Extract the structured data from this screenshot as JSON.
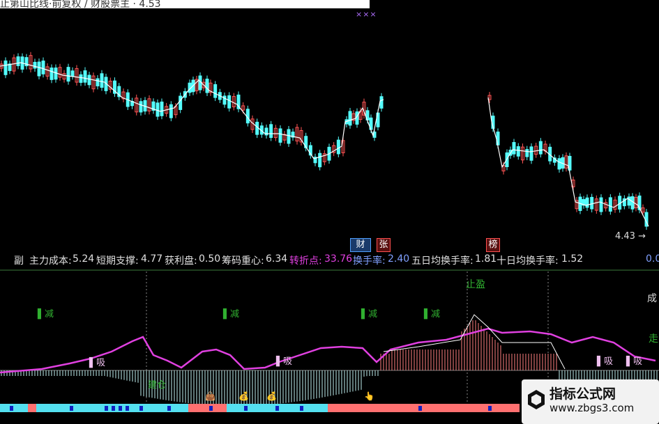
{
  "title_text": "止第山比线·前复权 / 财股票主 · 4.53",
  "price_label": "4.43",
  "badges": {
    "caijing": "财",
    "zhang": "张",
    "bang": "榜"
  },
  "stats": {
    "prefix": "副",
    "cost_label": "主力成本:",
    "cost_value": "5.24",
    "support_label": "短期支撑:",
    "support_value": "4.77",
    "profit_label": "获利盘:",
    "profit_value": "0.50",
    "center_label": "筹码重心:",
    "center_value": "6.34",
    "turn_label": "转折点:",
    "turn_value": "33.76",
    "rate_label": "换手率:",
    "rate_value": "2.40",
    "rate5_label": "五日均换手率:",
    "rate5_value": "1.81",
    "rate10_label": "十日均换手率:",
    "rate10_value": "1.52",
    "right_value": "0.0"
  },
  "signals": {
    "jian": "减",
    "xi": "吸",
    "zhiying": "止盈",
    "jiancang": "建仓",
    "cheng": "成",
    "zou": "走"
  },
  "watermark": {
    "title": "指标公式网",
    "url": "www.zbgs3.com"
  },
  "colors": {
    "up": "#ff5555",
    "down": "#54fcfc",
    "magenta": "#e040e0",
    "green": "#30a030",
    "white_line": "#ffffff"
  }
}
